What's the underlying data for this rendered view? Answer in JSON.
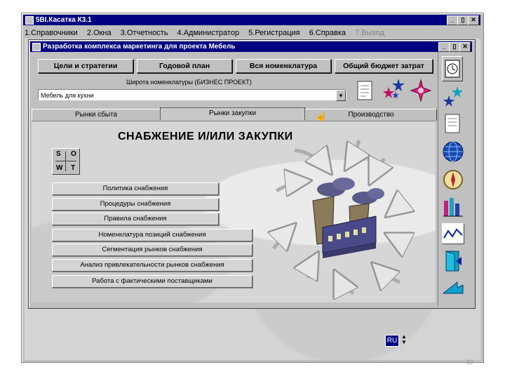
{
  "outer_window": {
    "title": "5BI.Касатка К3.1",
    "min": "_",
    "max": "▯",
    "close": "✕"
  },
  "menu": [
    "1.Справочники",
    "2.Окна",
    "3.Отчетность",
    "4.Администратор",
    "5.Регистрация",
    "6.Справка",
    "7.Выход"
  ],
  "inner_window": {
    "title": "Разработка комплекса маркетинга для проекта Мебель",
    "min": "_",
    "max": "▯",
    "close": "✕"
  },
  "top_buttons": [
    "Цели и стратегии",
    "Годовой план",
    "Вся номенклатура",
    "Общий бюджет затрат"
  ],
  "range_label": "Широта номенклатуры (БИЗНЕС ПРОЕКТ)",
  "range_select": {
    "value": "Мебель для кухни",
    "arrow": "▾"
  },
  "tabs": [
    "Рынки сбыта",
    "Рынки закупки",
    "Производство"
  ],
  "heading": "СНАБЖЕНИЕ И/ИЛИ ЗАКУПКИ",
  "swot": [
    "S",
    "O",
    "W",
    "T"
  ],
  "action_buttons": [
    "Политика снабжения",
    "Процедуры снабжения",
    "Правила снабжения",
    "Номенклатура позиций снабжения",
    "Сегментация рынков снабжения",
    "Анализ привлекательности рынков снабжения",
    "Работа с фактическими поставщиками"
  ],
  "status": {
    "lang": "RU",
    "page": "89"
  },
  "colors": {
    "titlebar": "#000080",
    "face": "#c0c0c0",
    "factory": "#4a4a8a",
    "factory_roof": "#8a7a5a"
  }
}
